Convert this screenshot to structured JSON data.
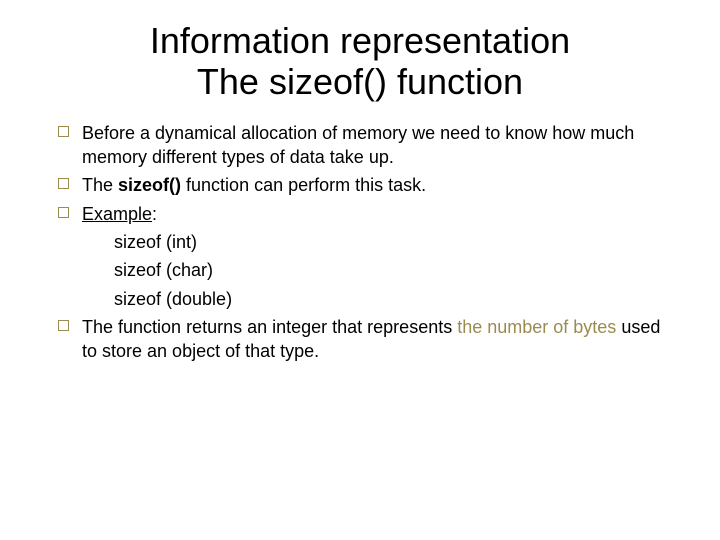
{
  "title": {
    "line1": "Information representation",
    "line2": "The sizeof() function"
  },
  "bullets": {
    "b0": {
      "text_pre": "Before a dynamical allocation of memory we need to know how much memory different types of data take up."
    },
    "b1": {
      "pre": "The ",
      "bold": "sizeof()",
      "post": " function can perform this task."
    },
    "b2": {
      "pre": "",
      "underline": "Example",
      "post": ":"
    },
    "indent0": "sizeof (int)",
    "indent1": "sizeof (char)",
    "indent2": "sizeof (double)",
    "b3": {
      "pre": "The function returns an integer that represents ",
      "accent": "the number of bytes",
      "post": " used to store an object of that type."
    }
  }
}
